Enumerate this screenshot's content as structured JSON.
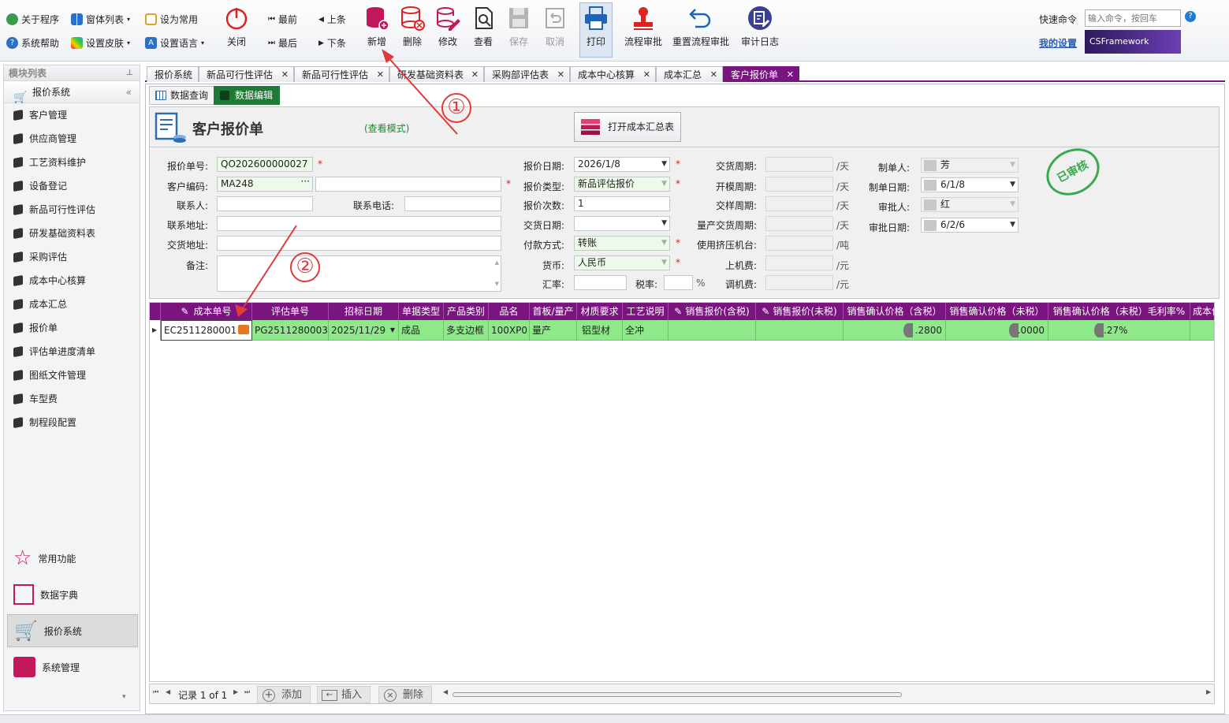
{
  "ribbon": {
    "about": "关于程序",
    "windows": "窗体列表",
    "set_common": "设为常用",
    "help": "系统帮助",
    "skin": "设置皮肤",
    "language": "设置语言",
    "close": "关闭",
    "first": "最前",
    "prev": "上条",
    "last": "最后",
    "next": "下条",
    "add": "新增",
    "delete": "删除",
    "edit": "修改",
    "view": "查看",
    "save": "保存",
    "cancel": "取消",
    "print": "打印",
    "flow_approve": "流程审批",
    "reset_flow": "重置流程审批",
    "audit_log": "审计日志",
    "quick_cmd_label": "快速命令",
    "quick_cmd_placeholder": "输入命令，按回车",
    "my_settings": "我的设置",
    "logo": "CSFramework"
  },
  "left": {
    "title": "模块列表",
    "group": "报价系统",
    "items": [
      "客户管理",
      "供应商管理",
      "工艺资料维护",
      "设备登记",
      "新品可行性评估",
      "研发基础资料表",
      "采购评估",
      "成本中心核算",
      "成本汇总",
      "报价单",
      "评估单进度清单",
      "图纸文件管理",
      "车型费",
      "制程段配置"
    ],
    "bottom": [
      "常用功能",
      "数据字典",
      "报价系统",
      "系统管理"
    ]
  },
  "tabs": [
    "报价系统",
    "新品可行性评估",
    "新品可行性评估",
    "研发基础资料表",
    "采购部评估表",
    "成本中心核算",
    "成本汇总",
    "客户报价单"
  ],
  "subtabs": {
    "query": "数据查询",
    "edit": "数据编辑"
  },
  "form": {
    "title": "客户报价单",
    "mode": "(查看模式)",
    "open_btn": "打开成本汇总表",
    "quote_no_label": "报价单号:",
    "quote_no": "QO202600000027",
    "cust_code_label": "客户编码:",
    "cust_code": "MA248",
    "cust_name": "",
    "contact_label": "联系人:",
    "contact": "",
    "phone_label": "联系电话:",
    "phone": "",
    "addr_label": "联系地址:",
    "addr": "",
    "deliv_addr_label": "交货地址:",
    "deliv_addr": "",
    "remark_label": "备注:",
    "remark": "",
    "quote_date_label": "报价日期:",
    "quote_date": "2026/1/8",
    "quote_type_label": "报价类型:",
    "quote_type": "新品评估报价",
    "quote_count_label": "报价次数:",
    "quote_count": "1",
    "deliv_date_label": "交货日期:",
    "deliv_date": "",
    "pay_label": "付款方式:",
    "pay": "转账",
    "currency_label": "货币:",
    "currency": "人民币",
    "rate_label": "汇率:",
    "rate": "",
    "tax_label": "税率:",
    "tax": "",
    "pct": "%",
    "deliv_cycle_label": "交货周期:",
    "mold_cycle_label": "开模周期:",
    "sample_cycle_label": "交样周期:",
    "mass_cycle_label": "量产交货周期:",
    "press_label": "使用挤压机台:",
    "load_fee_label": "上机费:",
    "adjust_fee_label": "调机费:",
    "unit_day": "/天",
    "unit_ton": "/吨",
    "unit_yuan": "/元",
    "maker_label": "制单人:",
    "maker": "芳",
    "make_date_label": "制单日期:",
    "make_date": "6/1/8",
    "approver_label": "审批人:",
    "approver": "红",
    "approve_date_label": "审批日期:",
    "approve_date": "6/2/6",
    "stamp": "已审核"
  },
  "grid": {
    "headers": [
      "成本单号",
      "评估单号",
      "招标日期",
      "单据类型",
      "产品类别",
      "品名",
      "首板/量产",
      "材质要求",
      "工艺说明",
      "销售报价(含税)",
      "销售报价(未税)",
      "销售确认价格（含税）",
      "销售确认价格（未税）",
      "销售确认价格（未税）毛利率%",
      "成本价"
    ],
    "row": [
      "EC2511280001",
      "PG2511280003",
      "2025/11/29",
      "成品",
      "多支边框",
      "100XP0",
      "量产",
      "铝型材",
      "全冲",
      "",
      "",
      ".2800",
      ".0000",
      ".27%",
      ""
    ]
  },
  "footer": {
    "record": "记录 1 of 1",
    "add": "添加",
    "insert": "插入",
    "delete": "删除"
  },
  "annotations": [
    "①",
    "②"
  ]
}
